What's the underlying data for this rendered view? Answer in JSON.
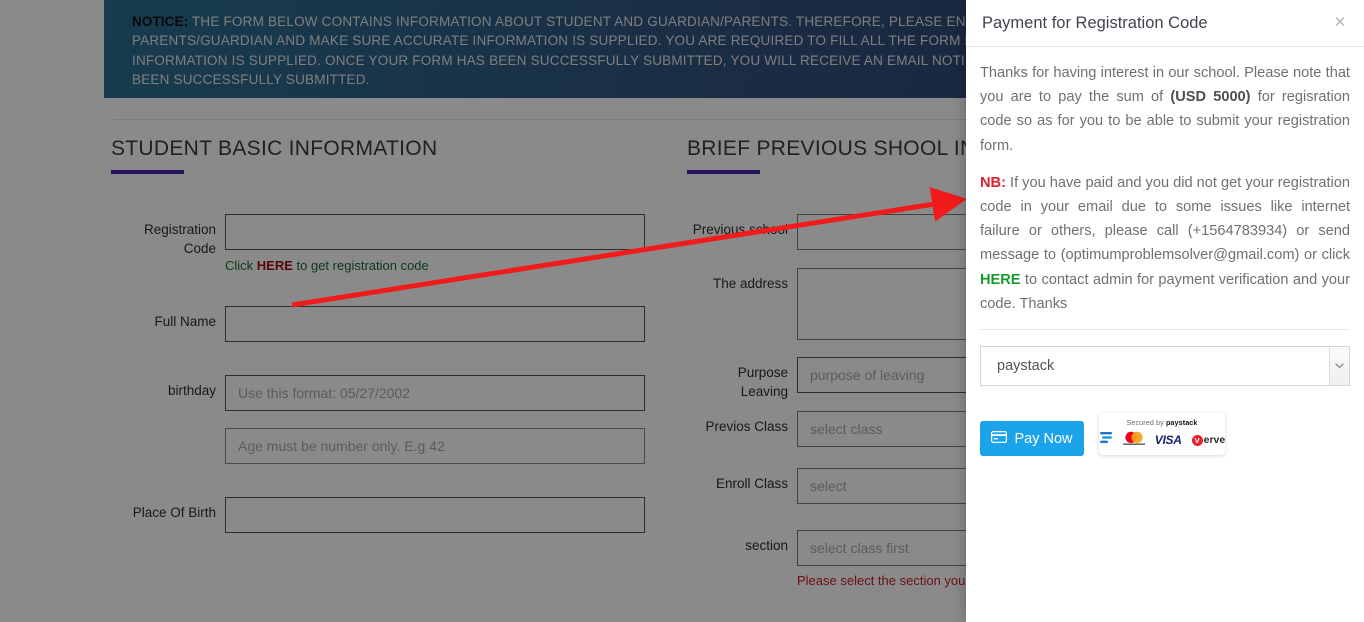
{
  "notice": {
    "label": "NOTICE:",
    "text": "THE FORM BELOW CONTAINS INFORMATION ABOUT STUDENT AND GUARDIAN/PARENTS. THEREFORE, PLEASE ENSURE YOU CONTACT YOUR PARENTS/GUARDIAN AND MAKE SURE ACCURATE INFORMATION IS SUPPLIED. YOU ARE REQUIRED TO FILL ALL THE FORM FIELDS AND MAKE SURE CORRECT INFORMATION IS SUPPLIED. ONCE YOUR FORM HAS BEEN SUCCESSFULLY SUBMITTED, YOU WILL RECEIVE AN EMAIL NOTIFYING YOU THAT YOUR FORM HAS BEEN SUCCESSFULLY SUBMITTED."
  },
  "student_section": {
    "title": "STUDENT BASIC INFORMATION",
    "fields": {
      "registration_code": {
        "label": "Registration Code",
        "value": "",
        "placeholder": "",
        "helper_prefix": "Click ",
        "helper_link": "HERE",
        "helper_suffix": " to get registration code"
      },
      "full_name": {
        "label": "Full Name",
        "value": "",
        "placeholder": ""
      },
      "birthday": {
        "label": "birthday",
        "value": "",
        "placeholder": "Use this format: 05/27/2002"
      },
      "age": {
        "label": "",
        "value": "",
        "placeholder": "Age must be number only. E.g 42"
      },
      "place_of_birth": {
        "label": "Place Of Birth",
        "value": "",
        "placeholder": ""
      }
    }
  },
  "previous_school_section": {
    "title": "BRIEF PREVIOUS SHOOL INFORMATION",
    "fields": {
      "previous_school": {
        "label": "Previous school",
        "value": "",
        "placeholder": ""
      },
      "the_address": {
        "label": "The address",
        "value": "",
        "placeholder": ""
      },
      "purpose_leaving": {
        "label": "Purpose Leaving",
        "value": "",
        "placeholder": "purpose of leaving"
      },
      "previos_class": {
        "label": "Previos Class",
        "value": "select class",
        "placeholder": "select class"
      },
      "enroll_class": {
        "label": "Enroll Class",
        "value": "select",
        "placeholder": "select"
      },
      "section": {
        "label": "section",
        "value": "select class first",
        "placeholder": "select class first",
        "error": "Please select the section you belong"
      }
    }
  },
  "modal": {
    "title": "Payment for Registration Code",
    "close_label": "×",
    "paragraph1": {
      "part1": "Thanks for having interest in our school. Please note that you are to pay the sum of ",
      "amount": "(USD 5000)",
      "part2": " for regisration code so as for you to be able to submit your registration form."
    },
    "paragraph2": {
      "nb": "NB:",
      "part1": " If you have paid and you did not get your registration code in your email due to some issues like internet failure or others, please call (+1564783934) or send message to (optimumproblemsolver@gmail.com) or click ",
      "link": "HERE",
      "part2": " to contact admin for payment verification and your code. Thanks"
    },
    "gateway_select": {
      "value": "paystack",
      "options": [
        "paystack"
      ]
    },
    "pay_button": "Pay Now",
    "secure_badge": {
      "prefix": "Secured by ",
      "brand": "paystack",
      "cards": [
        "bank-transfer",
        "mastercard",
        "VISA",
        "Verve"
      ]
    }
  },
  "colors": {
    "accent_purple": "#4b25ae",
    "pay_blue": "#1ca4eb",
    "nb_red": "#d9232d",
    "here_green": "#169b2f",
    "error_red": "#cc2028"
  }
}
